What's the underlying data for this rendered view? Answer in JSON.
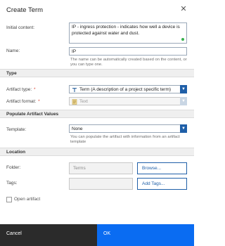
{
  "dialog": {
    "title": "Create Term",
    "close_icon": "close-icon"
  },
  "fields": {
    "initial_content_label": "Initial content:",
    "initial_content_value": "IP - ingress protection - indicates how well a device is protected against water and dust.",
    "name_label": "Name:",
    "name_value": "IP",
    "name_hint": "The name can be automatically created based on the content, or you can type one."
  },
  "type_section": {
    "title": "Type",
    "artifact_type_label": "Artifact type:",
    "artifact_type_value": "Term (A description of a project specific term)",
    "artifact_format_label": "Artifact format:",
    "artifact_format_value": "Text",
    "required_marker": "*"
  },
  "populate_section": {
    "title": "Populate Artifact Values",
    "template_label": "Template:",
    "template_value": "None",
    "template_hint": "You can populate the artifact with information from an artifact template"
  },
  "location_section": {
    "title": "Location",
    "folder_label": "Folder:",
    "folder_value": "Terms",
    "browse_button": "Browse...",
    "tags_label": "Tags:",
    "tags_value": "",
    "add_tags_button": "Add Tags..."
  },
  "open_artifact": {
    "label": "Open artifact",
    "checked": false
  },
  "footer": {
    "cancel_label": "Cancel",
    "ok_label": "OK"
  },
  "colors": {
    "primary": "#0a6cf2",
    "dropdown_arrow": "#1f5fa8",
    "cancel_bg": "#2b2b2b",
    "required": "#d9331f"
  }
}
